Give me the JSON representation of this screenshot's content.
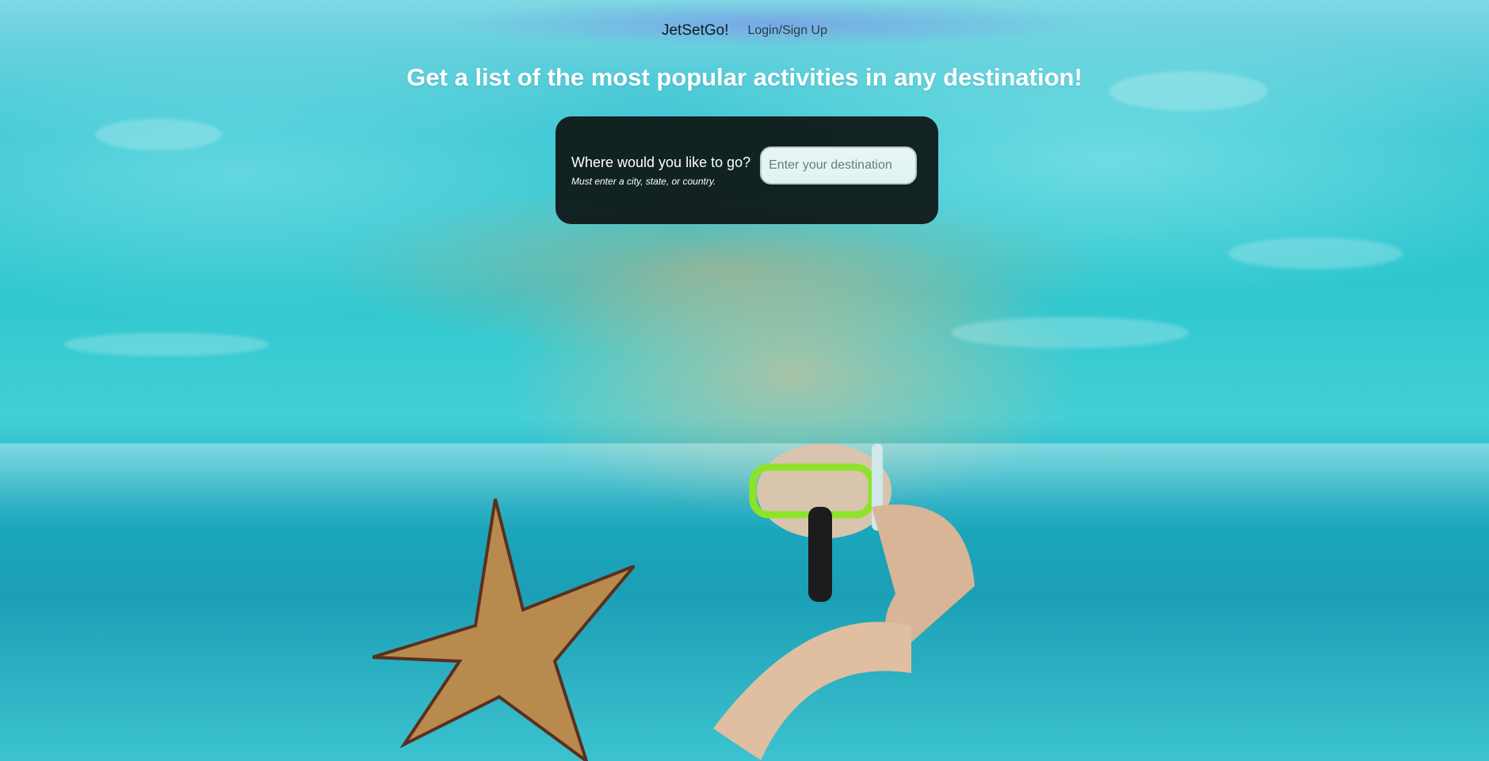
{
  "nav": {
    "brand": "JetSetGo!",
    "login_label": "Login/Sign Up"
  },
  "hero": {
    "headline": "Get a list of the most popular activities in any destination!"
  },
  "search": {
    "question": "Where would you like to go?",
    "hint": "Must enter a city, state, or country.",
    "placeholder": "Enter your destination",
    "value": ""
  },
  "background": {
    "description_icon": "underwater-snorkeler-photo",
    "colors": {
      "water": "#2fc7cf",
      "card": "#0c1010",
      "input_bg": "#e8f6f5"
    }
  }
}
